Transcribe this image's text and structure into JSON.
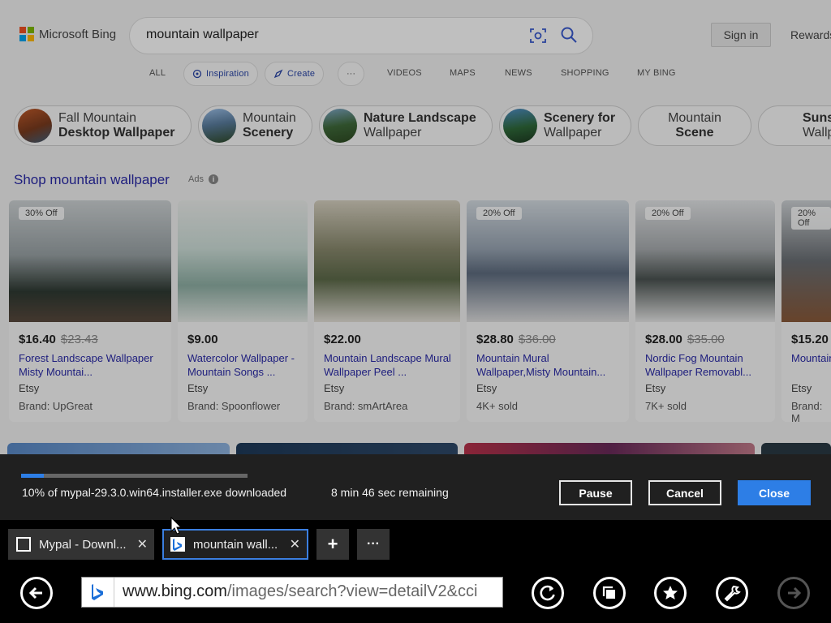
{
  "colors": {
    "accent": "#2d7ee6",
    "link": "#2a2aa8",
    "download_bg": "#202020"
  },
  "bing": {
    "logo_text": "Microsoft Bing",
    "query": "mountain wallpaper",
    "sign_in": "Sign in",
    "rewards": "Rewards",
    "nav": {
      "all": "ALL",
      "inspiration": "Inspiration",
      "create": "Create",
      "more": "···",
      "videos": "VIDEOS",
      "maps": "MAPS",
      "news": "NEWS",
      "shopping": "SHOPPING",
      "my_bing": "MY BING"
    },
    "chips": [
      {
        "line1": "Fall Mountain",
        "line2": "Desktop Wallpaper"
      },
      {
        "line1": "Mountain",
        "line2": "Scenery"
      },
      {
        "line1": "Nature Landscape",
        "line2": "Wallpaper"
      },
      {
        "line1": "Scenery for",
        "line2": "Wallpaper"
      },
      {
        "line1": "Mountain",
        "line2": "Scene"
      },
      {
        "line1": "Suns",
        "line2": "Wallp"
      }
    ],
    "shop_title": "Shop mountain wallpaper",
    "ads_label": "Ads",
    "products": [
      {
        "badge": "30% Off",
        "price": "$16.40",
        "old_price": "$23.43",
        "title": "Forest Landscape Wallpaper Misty Mountai...",
        "seller": "Etsy",
        "extra": "Brand: UpGreat"
      },
      {
        "badge": "",
        "price": "$9.00",
        "old_price": "",
        "title": "Watercolor Wallpaper - Mountain Songs ...",
        "seller": "Etsy",
        "extra": "Brand: Spoonflower"
      },
      {
        "badge": "",
        "price": "$22.00",
        "old_price": "",
        "title": "Mountain Landscape Mural Wallpaper Peel ...",
        "seller": "Etsy",
        "extra": "Brand: smArtArea"
      },
      {
        "badge": "20% Off",
        "price": "$28.80",
        "old_price": "$36.00",
        "title": "Mountain Mural Wallpaper,Misty Mountain...",
        "seller": "Etsy",
        "extra": "4K+ sold"
      },
      {
        "badge": "20% Off",
        "price": "$28.00",
        "old_price": "$35.00",
        "title": "Nordic Fog Mountain Wallpaper Removabl...",
        "seller": "Etsy",
        "extra": "7K+ sold"
      },
      {
        "badge": "20% Off",
        "price": "$15.20",
        "old_price": "",
        "title": "Mountain Wallpaper",
        "seller": "Etsy",
        "extra": "Brand: M"
      }
    ]
  },
  "download": {
    "progress": 0.1,
    "status": "10% of mypal-29.3.0.win64.installer.exe downloaded",
    "remaining": "8 min 46 sec remaining",
    "pause": "Pause",
    "cancel": "Cancel",
    "close": "Close"
  },
  "tabs": [
    {
      "label": "Mypal - Downl...",
      "close": "✕",
      "active": false
    },
    {
      "label": "mountain wall...",
      "close": "✕",
      "active": true
    }
  ],
  "tab_controls": {
    "new_tab": "+",
    "more": "···"
  },
  "address_bar": {
    "url_host": "www.bing.com",
    "url_path": "/images/search?view=detailV2&cci"
  }
}
